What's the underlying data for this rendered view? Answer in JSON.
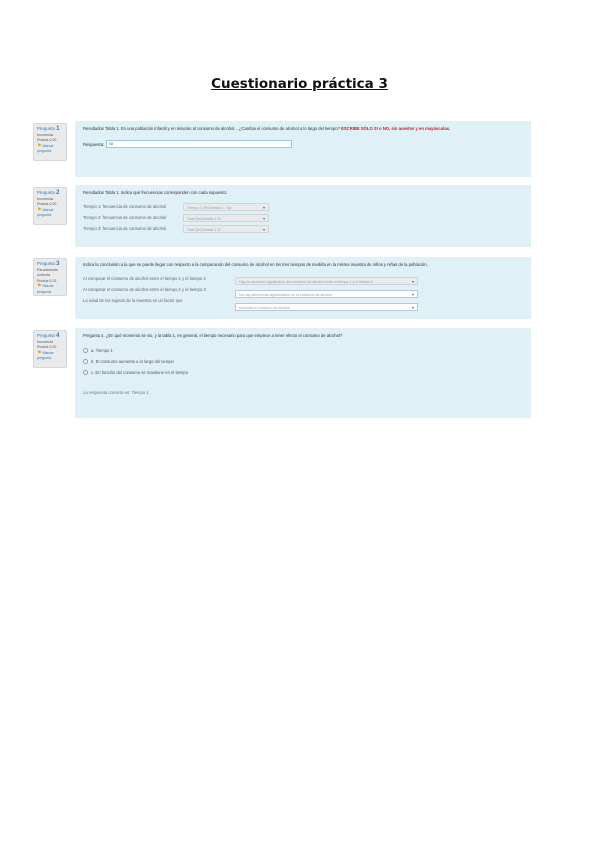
{
  "title": "Cuestionario práctica 3",
  "questions": [
    {
      "label": "Pregunta",
      "number": "1",
      "status": "Incorrecta",
      "score": "Puntúa 0,00",
      "flag": "Marcar pregunta",
      "text": "Resultados Tabla 1. En una población infantil y en relación al consumo de alcohol... ¿Cambia el consumo de alcohol a lo largo del tiempo?",
      "emphasis": "ESCRIBE SÓLO SI o NO, sin acentos y en mayúsculas.",
      "answer_label": "Respuesta:",
      "answer_value": "Si"
    },
    {
      "label": "Pregunta",
      "number": "2",
      "status": "Incorrecta",
      "score": "Puntúa 0,00",
      "flag": "Marcar pregunta",
      "text": "Resultados Tabla 1. Indica qué frecuencias corresponden con cada supuesto:",
      "rows": [
        {
          "label": "Tiempo 1: frecuencia de consumo de alcohol",
          "select": "Tiempo 1 (%) Bebida 1 - No"
        },
        {
          "label": "Tiempo 2: frecuencia de consumo de alcohol",
          "select": "Total (%) Bebida 1 Si"
        },
        {
          "label": "Tiempo 3: frecuencia de consumo de alcohol",
          "select": "Total (%) Bebida 1 Si"
        }
      ]
    },
    {
      "label": "Pregunta",
      "number": "3",
      "status": "Parcialmente correcta",
      "score": "Puntúa 0,33",
      "flag": "Marcar pregunta",
      "text": "Indica la conclusión a la que se puede llegar con respecto a la comparación del consumo de alcohol en los tres tiempos de medida en la misma muestra de niños y niñas de la población.",
      "rows": [
        {
          "label": "Al comparar el consumo de alcohol entre el tiempo 1 y el tiempo 2",
          "select": "Hay un aumento significativo del consumo de alcohol entre el tiempo 1 y el tiempo 2"
        },
        {
          "label": "Al comparar el consumo de alcohol entre el tiempo 2 y el tiempo 3",
          "select": "No hay diferencias significativas en el consumo de alcohol"
        },
        {
          "label": "La edad de los sujetos de la muestra es un factor que",
          "select": "aumenta el consumo de alcohol"
        }
      ]
    },
    {
      "label": "Pregunta",
      "number": "4",
      "status": "Incorrecta",
      "score": "Puntúa 0,00",
      "flag": "Marcar pregunta",
      "text": "Pregunta 4. ¿En qué momento se vio, y la tabla 1, en general, el tiempo necesario para que empiece a tener efecto el consumo de alcohol?",
      "options": [
        "a. Tiempo 1",
        "b. El consumo aumenta a lo largo del tiempo",
        "c. En función del consumo se mantiene en el tiempo"
      ],
      "feedback": "La respuesta correcta es: Tiempo 1"
    }
  ]
}
